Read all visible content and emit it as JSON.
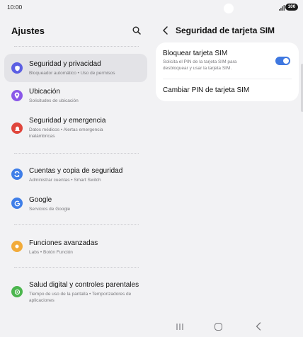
{
  "status_bar": {
    "time": "10:00",
    "battery": "100",
    "icons": [
      "signal-icon",
      "battery-icon"
    ]
  },
  "left_pane": {
    "title": "Ajustes",
    "search_icon": "search-icon",
    "items": [
      {
        "title": "Seguridad y privacidad",
        "subtitle": "Bloqueador automático • Uso de permisos",
        "icon": "shield-icon",
        "color": "#5c5fe3",
        "selected": true
      },
      {
        "title": "Ubicación",
        "subtitle": "Solicitudes de ubicación",
        "icon": "location-icon",
        "color": "#8a57e8"
      },
      {
        "title": "Seguridad y emergencia",
        "subtitle": "Datos médicos • Alertas emergencia inalámbricas",
        "icon": "emergency-icon",
        "color": "#e0463c"
      },
      {
        "title": "Cuentas y copia de seguridad",
        "subtitle": "Administrar cuentas • Smart Switch",
        "icon": "sync-icon",
        "color": "#3f7ee8"
      },
      {
        "title": "Google",
        "subtitle": "Servicios de Google",
        "icon": "google-icon",
        "color": "#3f7ee8"
      },
      {
        "title": "Funciones avanzadas",
        "subtitle": "Labs • Botón Función",
        "icon": "star-icon",
        "color": "#f2ab3a"
      },
      {
        "title": "Salud digital y controles parentales",
        "subtitle": "Tiempo de uso de la pantalla • Temporizadores de aplicaciones",
        "icon": "digital-wellbeing-icon",
        "color": "#4cb64e"
      }
    ]
  },
  "right_pane": {
    "title": "Seguridad de tarjeta SIM",
    "back_icon": "back-arrow-icon",
    "lock_sim": {
      "title": "Bloquear tarjeta SIM",
      "description": "Solicita el PIN de la tarjeta SIM para desbloquear y usar la tarjeta SIM.",
      "enabled": true,
      "toggle_color": "#3f78e0"
    },
    "change_pin": {
      "title": "Cambiar PIN de tarjeta SIM"
    }
  },
  "nav_bar": {
    "icons": [
      "recents-icon",
      "home-icon",
      "back-icon"
    ]
  }
}
